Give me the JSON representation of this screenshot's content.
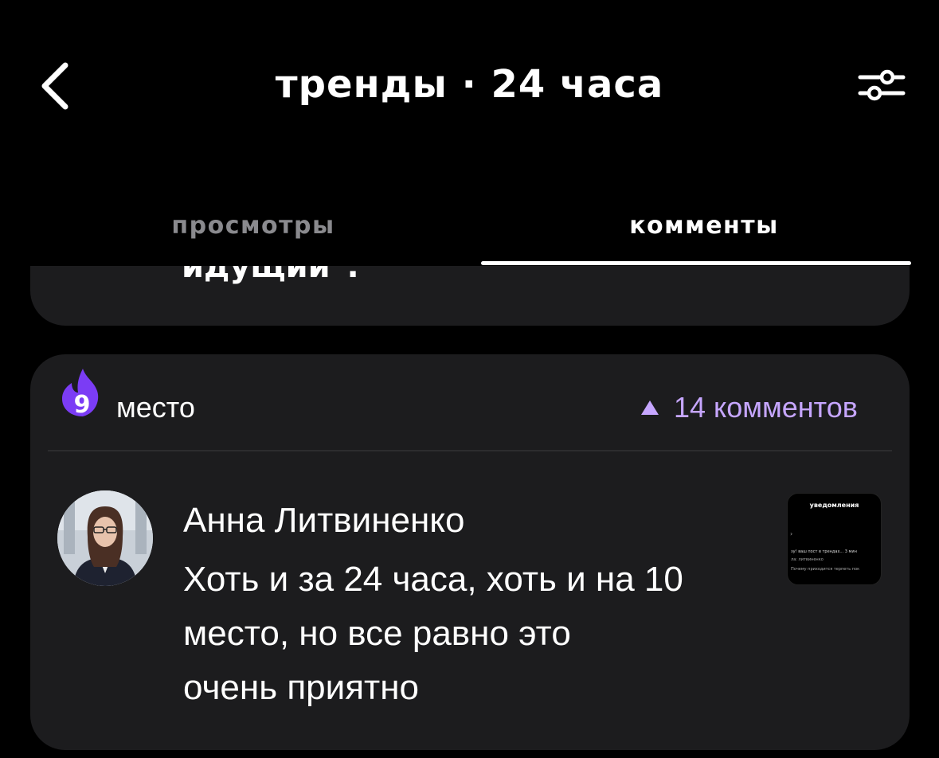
{
  "header": {
    "title": "тренды · 24 часа",
    "back_icon": "chevron-left-icon",
    "filter_icon": "sliders-icon"
  },
  "tabs": [
    {
      "label": "просмотры",
      "active": false
    },
    {
      "label": "комменты",
      "active": true
    }
  ],
  "previous_card": {
    "partial_text": "идущий\"."
  },
  "card": {
    "rank": "9",
    "rank_label": "место",
    "trend_icon": "triangle-up-icon",
    "comment_count": "14 комментов",
    "author": "Анна Литвиненко",
    "comment_lines": [
      "Хоть и за 24 часа, хоть и на 10",
      "место, но все равно это",
      "очень приятно"
    ],
    "thumbnail": {
      "title": "уведомления",
      "lines": [
        "зу! ваш пост в трендах...  3 мин",
        "ла: литвиненко",
        "Почему приходится терпеть пок"
      ]
    }
  },
  "colors": {
    "background": "#000000",
    "card": "#1c1c1e",
    "accent": "#c6a6ff",
    "flame": "#7b3cf5",
    "muted": "#8a8a8e"
  }
}
